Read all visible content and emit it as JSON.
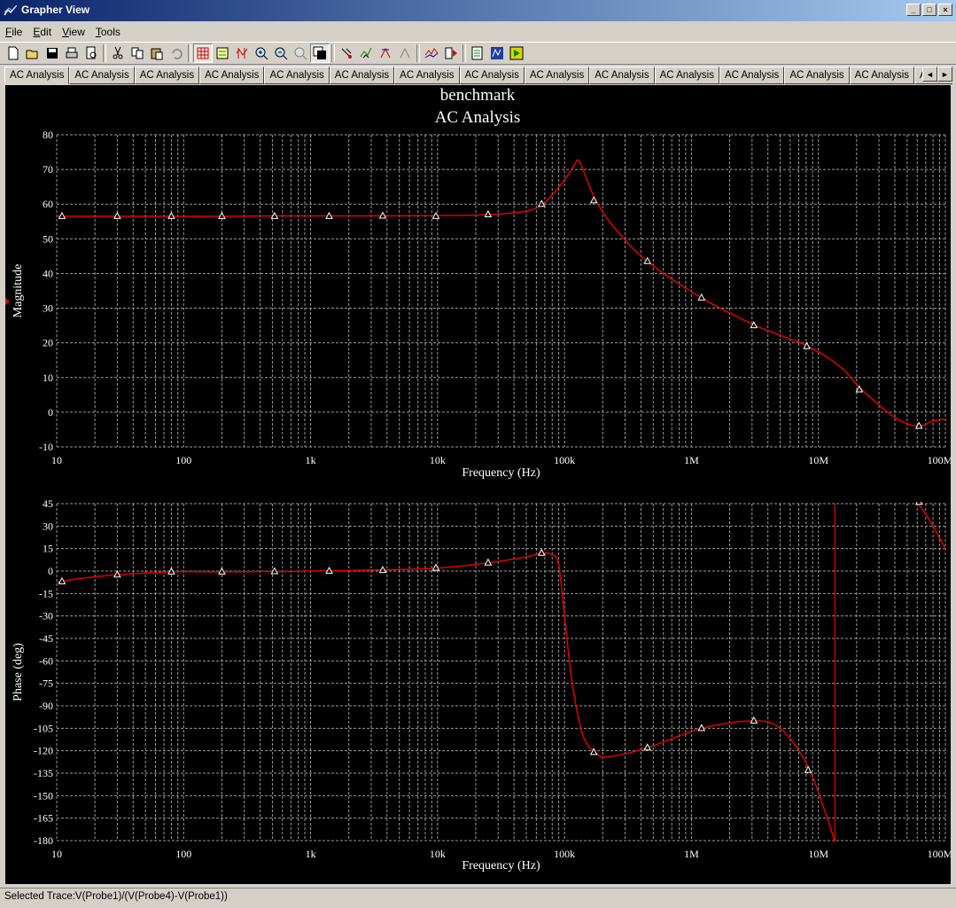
{
  "window": {
    "title": "Grapher View",
    "buttons": [
      "_",
      "□",
      "×"
    ]
  },
  "menu": [
    {
      "label": "File",
      "accel": "F",
      "rest": "ile"
    },
    {
      "label": "Edit",
      "accel": "E",
      "rest": "dit"
    },
    {
      "label": "View",
      "accel": "V",
      "rest": "iew"
    },
    {
      "label": "Tools",
      "accel": "T",
      "rest": "ools"
    }
  ],
  "toolbar": {
    "icons": [
      "new-icon",
      "open-icon",
      "save-icon",
      "print-icon",
      "print-preview-icon",
      "cut-icon",
      "copy-icon",
      "paste-icon",
      "undo-icon",
      "grid-icon",
      "legend-icon",
      "cursors-icon",
      "zoom-in-icon",
      "zoom-out-icon",
      "zoom-fit-icon",
      "background-icon",
      "select-marks-icon",
      "show-marks-icon",
      "reverse-colors-icon",
      "rescale-icon",
      "overlay-traces-icon",
      "properties-icon",
      "export-excel-icon",
      "export-mathcad-icon",
      "export-labview-icon"
    ],
    "active": [
      "grid-icon",
      "background-icon"
    ]
  },
  "tabs": [
    "AC Analysis",
    "AC Analysis",
    "AC Analysis",
    "AC Analysis",
    "AC Analysis",
    "AC Analysis",
    "AC Analysis",
    "AC Analysis",
    "AC Analysis",
    "AC Analysis",
    "AC Analysis",
    "AC Analysis",
    "AC Analysis",
    "AC Analysis",
    "AC Analysis",
    "A"
  ],
  "tab_scroll": [
    "◄",
    "►"
  ],
  "plot": {
    "title": "benchmark",
    "subtitle": "AC Analysis"
  },
  "chart_data": [
    {
      "type": "line",
      "title": "benchmark",
      "subtitle": "AC Analysis",
      "xlabel": "Frequency (Hz)",
      "ylabel": "Magnitude",
      "xscale": "log",
      "xlim": [
        10,
        100000000
      ],
      "ylim": [
        -10,
        80
      ],
      "xticks": [
        "10",
        "100",
        "1k",
        "10k",
        "100k",
        "1M",
        "10M",
        "100M"
      ],
      "yticks": [
        "-10",
        "0",
        "10",
        "20",
        "30",
        "40",
        "50",
        "60",
        "70",
        "80"
      ],
      "grid": true,
      "color": "#e00000",
      "series": [
        {
          "x": [
            10,
            30,
            80,
            200,
            500,
            1400,
            3700,
            10000,
            26000,
            50000,
            70000,
            100000,
            120000,
            130000,
            150000,
            180000,
            250000,
            450000,
            1200000,
            3200000,
            8300000,
            15000000,
            22000000,
            40000000,
            60000000,
            80000000,
            100000000
          ],
          "y": [
            56.5,
            56.5,
            56.5,
            56.5,
            56.6,
            56.6,
            56.6,
            56.7,
            57,
            58,
            60.5,
            67,
            71.5,
            72.5,
            67,
            60.5,
            53,
            43.5,
            33,
            25,
            19,
            13,
            6.5,
            -1.5,
            -4,
            -2.5,
            -2
          ],
          "markers_x": [
            11,
            30,
            80,
            200,
            520,
            1400,
            3700,
            9700,
            25000,
            66000,
            170000,
            450000,
            1200000,
            3100000,
            8100000,
            21000000,
            62000000
          ],
          "markers_y": [
            56.5,
            56.5,
            56.5,
            56.5,
            56.5,
            56.5,
            56.6,
            56.5,
            57,
            60,
            61,
            43.5,
            33,
            25,
            19,
            6.5,
            -4
          ]
        }
      ]
    },
    {
      "type": "line",
      "xlabel": "Frequency (Hz)",
      "ylabel": "Phase (deg)",
      "xscale": "log",
      "xlim": [
        10,
        100000000
      ],
      "ylim": [
        -180,
        45
      ],
      "xticks": [
        "10",
        "100",
        "1k",
        "10k",
        "100k",
        "1M",
        "10M",
        "100M"
      ],
      "yticks": [
        "45",
        "30",
        "15",
        "0",
        "-15",
        "-30",
        "-45",
        "-60",
        "-75",
        "-90",
        "-105",
        "-120",
        "-135",
        "-150",
        "-165",
        "-180"
      ],
      "grid": true,
      "color": "#e00000",
      "series": [
        {
          "x": [
            10,
            15,
            30,
            80,
            200,
            520,
            1400,
            3700,
            10000,
            25000,
            50000,
            66000,
            80000,
            90000,
            100000,
            115000,
            140000,
            180000,
            220000,
            450000,
            1200000,
            3100000,
            5000000,
            8000000,
            11000000,
            13500000
          ],
          "y": [
            -7.5,
            -5,
            -2.5,
            -0.5,
            -0.5,
            -0.3,
            0.2,
            0.8,
            2,
            5.5,
            9.5,
            12,
            11,
            4,
            -30,
            -75,
            -110,
            -122,
            -124,
            -118,
            -105,
            -100,
            -105,
            -128,
            -158,
            -181
          ],
          "markers_x": [
            11,
            30,
            80,
            200,
            520,
            1400,
            3700,
            9700,
            25000,
            66000,
            170000,
            450000,
            1200000,
            3100000,
            8300000
          ],
          "markers_y": [
            -7,
            -2.5,
            -0.5,
            -0.5,
            -0.3,
            0,
            0.5,
            2,
            5.5,
            12,
            -121,
            -118,
            -105,
            -100,
            -133
          ]
        },
        {
          "x": [
            60000000,
            70000000,
            80000000,
            100000000
          ],
          "y": [
            46,
            38,
            30,
            15
          ],
          "markers_x": [
            62000000
          ],
          "markers_y": [
            46
          ]
        }
      ],
      "cursor_x": 13500000
    }
  ],
  "status": {
    "text": "Selected Trace:V(Probe1)/(V(Probe4)-V(Probe1))"
  }
}
